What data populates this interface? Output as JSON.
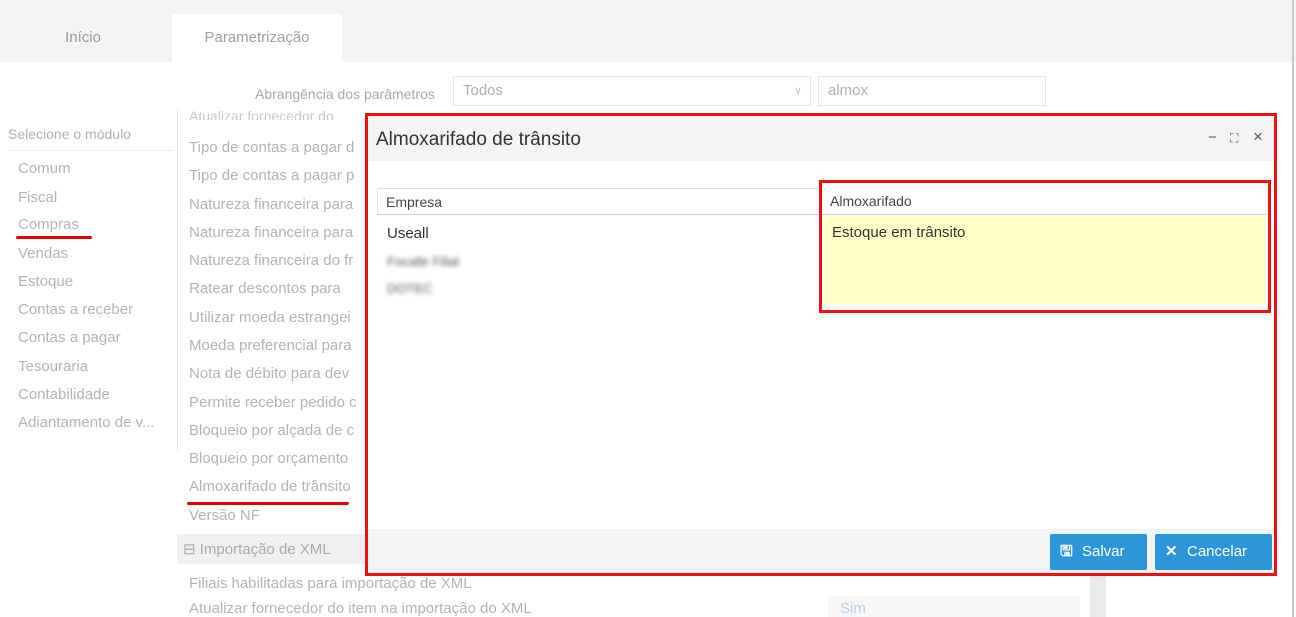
{
  "tabs": [
    {
      "label": "Início"
    },
    {
      "label": "Parametrização"
    }
  ],
  "filter": {
    "label": "Abrangência dos parâmetros",
    "scope_value": "Todos",
    "search_value": "almox"
  },
  "modules": {
    "header": "Selecione o módulo",
    "items": [
      {
        "label": "Comum"
      },
      {
        "label": "Fiscal"
      },
      {
        "label": "Compras"
      },
      {
        "label": "Vendas"
      },
      {
        "label": "Estoque"
      },
      {
        "label": "Contas a receber"
      },
      {
        "label": "Contas a pagar"
      },
      {
        "label": "Tesouraria"
      },
      {
        "label": "Contabilidade"
      },
      {
        "label": "Adiantamento de v..."
      }
    ]
  },
  "params": {
    "top_partial": "Atualizar fornecedor do",
    "items": [
      {
        "label": "Tipo de contas a pagar d"
      },
      {
        "label": "Tipo de contas a pagar p"
      },
      {
        "label": "Natureza financeira para"
      },
      {
        "label": "Natureza financeira para"
      },
      {
        "label": "Natureza financeira do fr"
      },
      {
        "label": "Ratear descontos para"
      },
      {
        "label": "Utilizar moeda estrangei"
      },
      {
        "label": "Moeda preferencial para"
      },
      {
        "label": "Nota de débito para dev"
      },
      {
        "label": "Permite receber pedido c"
      },
      {
        "label": "Bloqueio por alçada de c"
      },
      {
        "label": "Bloqueio por orçamento"
      },
      {
        "label": "Almoxarifado de trânsito"
      },
      {
        "label": "Versão NF"
      }
    ],
    "section": "⊟ Importação de XML",
    "bottom": [
      {
        "label": "Filiais habilitadas para importação de XML"
      },
      {
        "label": "Atualizar fornecedor do item na importação do XML"
      }
    ],
    "bottom_value": "Sim"
  },
  "modal": {
    "title": "Almoxarifado de trânsito",
    "controls": {
      "minimize": "−",
      "maximize": "⛶",
      "close": "×"
    },
    "columns": {
      "empresa": "Empresa",
      "almoxarifado": "Almoxarifado"
    },
    "empresas": [
      "Useall",
      "Focalle Filial",
      "DOTEC"
    ],
    "almoxarifado_value": "Estoque em trânsito",
    "buttons": {
      "save": "Salvar",
      "cancel": "Cancelar"
    }
  },
  "colors": {
    "accent": "#2d96d9",
    "highlight": "#ee1111",
    "cell": "#fefec6"
  }
}
